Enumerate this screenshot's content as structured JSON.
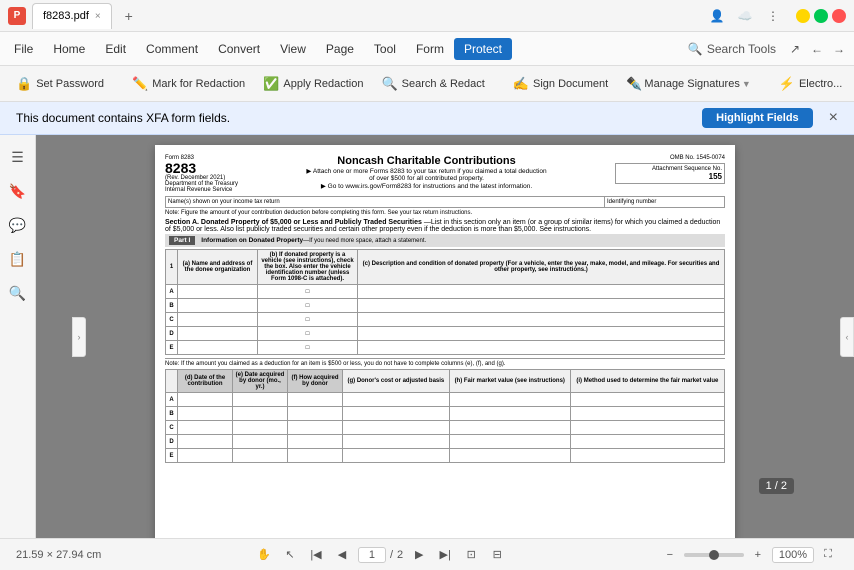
{
  "titleBar": {
    "appIcon": "P",
    "fileName": "f8283.pdf",
    "closeTab": "×",
    "newTab": "+",
    "searchPlaceholder": "Search Tools",
    "windowBtns": [
      "−",
      "❐",
      "×"
    ]
  },
  "menuBar": {
    "items": [
      {
        "label": "File",
        "active": false
      },
      {
        "label": "Home",
        "active": false
      },
      {
        "label": "Edit",
        "active": false
      },
      {
        "label": "Comment",
        "active": false
      },
      {
        "label": "Convert",
        "active": false
      },
      {
        "label": "View",
        "active": false
      },
      {
        "label": "Page",
        "active": false
      },
      {
        "label": "Tool",
        "active": false
      },
      {
        "label": "Form",
        "active": false
      },
      {
        "label": "Protect",
        "active": true
      }
    ],
    "searchTools": "Search Tools"
  },
  "toolbar": {
    "buttons": [
      {
        "icon": "🔒",
        "label": "Set Password"
      },
      {
        "icon": "✏️",
        "label": "Mark for Redaction"
      },
      {
        "icon": "✅",
        "label": "Apply Redaction"
      },
      {
        "icon": "🔍",
        "label": "Search & Redact"
      },
      {
        "icon": "✍️",
        "label": "Sign Document"
      },
      {
        "icon": "✒️",
        "label": "Manage Signatures",
        "hasDropdown": true
      },
      {
        "icon": "⚡",
        "label": "Electro..."
      }
    ]
  },
  "xfaNotice": {
    "message": "This document contains XFA form fields.",
    "buttonLabel": "Highlight Fields",
    "closeLabel": "×"
  },
  "sidebar": {
    "icons": [
      "☰",
      "🔖",
      "💬",
      "📋",
      "🔍"
    ]
  },
  "pdf": {
    "formNumber": "8283",
    "formTitle": "Noncash Charitable Contributions",
    "formLine1": "▶ Attach one or more Forms 8283 to your tax return if you claimed a total deduction",
    "formLine2": "of over $500 for all contributed property.",
    "formLine3": "▶ Go to www.irs.gov/Form8283 for instructions and the latest information.",
    "formRev": "Form 8283",
    "formRevDate": "(Rev. December 2021)",
    "dept": "Department of the Treasury",
    "irs": "Internal Revenue Service",
    "nameLabel": "Name(s) shown on your income tax return",
    "identifyingLabel": "Identifying number",
    "ombLabel": "OMB No. 1545-0074",
    "attachmentLabel": "Attachment Sequence No.",
    "attachmentNo": "155",
    "note1": "Note: Figure the amount of your contribution deduction before completing this form. See your tax return instructions.",
    "sectionATitle": "Section A. Donated Property of $5,000 or Less and Publicly Traded Securities",
    "sectionADesc": "—List in this section only an item (or a group of similar items) for which you claimed a deduction of $5,000 or less. Also list publicly traded securities and certain other property even if the deduction is more than $5,000. See instructions.",
    "partI": "Part I",
    "partITitle": "Information on Donated Property",
    "partIDesc": "—If you need more space, attach a statement.",
    "col1": "(a) Name and address of the\ndonee organization",
    "col2": "(b) If donated property is a vehicle (see instructions), check the box.\nAlso enter the vehicle identification number (unless Form 1098-C is\nattached).",
    "col3": "(c) Description and condition of donated property\n(For a vehicle, enter the year, make, model, and mileage. For\nsecurities and other property,\nsee instructions.)",
    "rows": [
      "A",
      "B",
      "C",
      "D",
      "E"
    ],
    "noteBottom": "Note: If the amount you claimed as a deduction for an item is $500 or less, you do not have to complete columns (e), (f), and (g).",
    "col4": "(d) Date of the\ncontribution",
    "col5": "(e) Date acquired\nby donor (mo., yr.)",
    "col6": "(f) How acquired\nby donor",
    "col7": "(g) Donor's cost\nor adjusted basis",
    "col8": "(h) Fair market value\n(see instructions)",
    "col9": "(i) Method used to determine\nthe fair market value",
    "rows2": [
      "A",
      "B",
      "C",
      "D",
      "E"
    ]
  },
  "statusBar": {
    "dimensions": "21.59 × 27.94 cm",
    "currentPage": "1",
    "totalPages": "2",
    "pageBadge": "1 / 2",
    "zoomLevel": "100%"
  }
}
